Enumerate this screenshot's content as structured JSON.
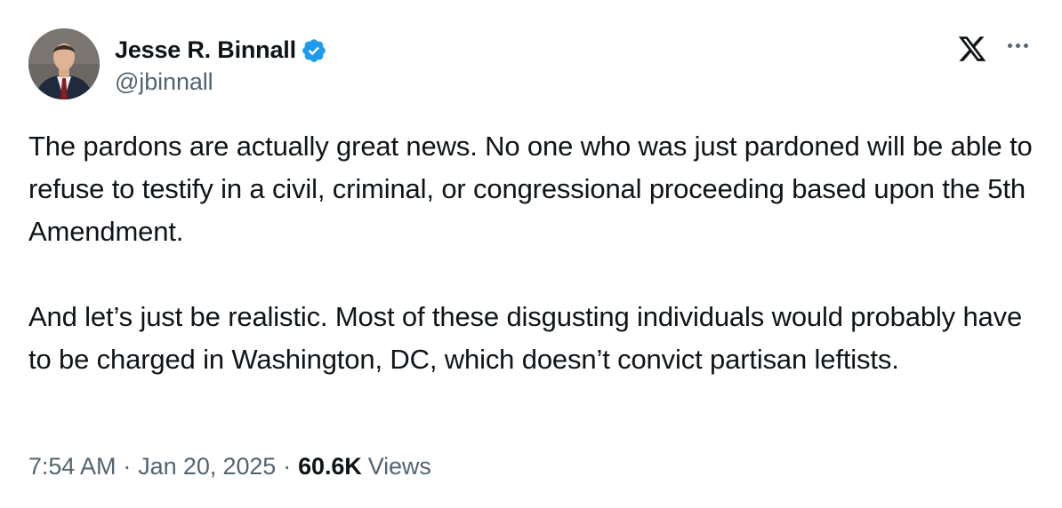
{
  "author": {
    "display_name": "Jesse R. Binnall",
    "handle": "@jbinnall",
    "verified": true
  },
  "tweet": {
    "paragraphs": [
      "The pardons are actually great news. No one who was just pardoned will be able to refuse to testify in a civil, criminal, or congressional proceeding based upon the 5th Amendment.",
      "And let’s just be realistic. Most of these disgusting individuals would probably have to be charged in Washington, DC, which doesn’t convict partisan leftists."
    ]
  },
  "meta": {
    "time": "7:54 AM",
    "separator": "·",
    "date": "Jan 20, 2025",
    "views_count": "60.6K",
    "views_label": "Views"
  },
  "colors": {
    "text_primary": "#0f1419",
    "text_secondary": "#536471",
    "verified_blue": "#1d9bf0"
  },
  "icons": {
    "verified": "verified-badge-icon",
    "logo": "x-logo-icon",
    "more": "more-dots-icon"
  }
}
